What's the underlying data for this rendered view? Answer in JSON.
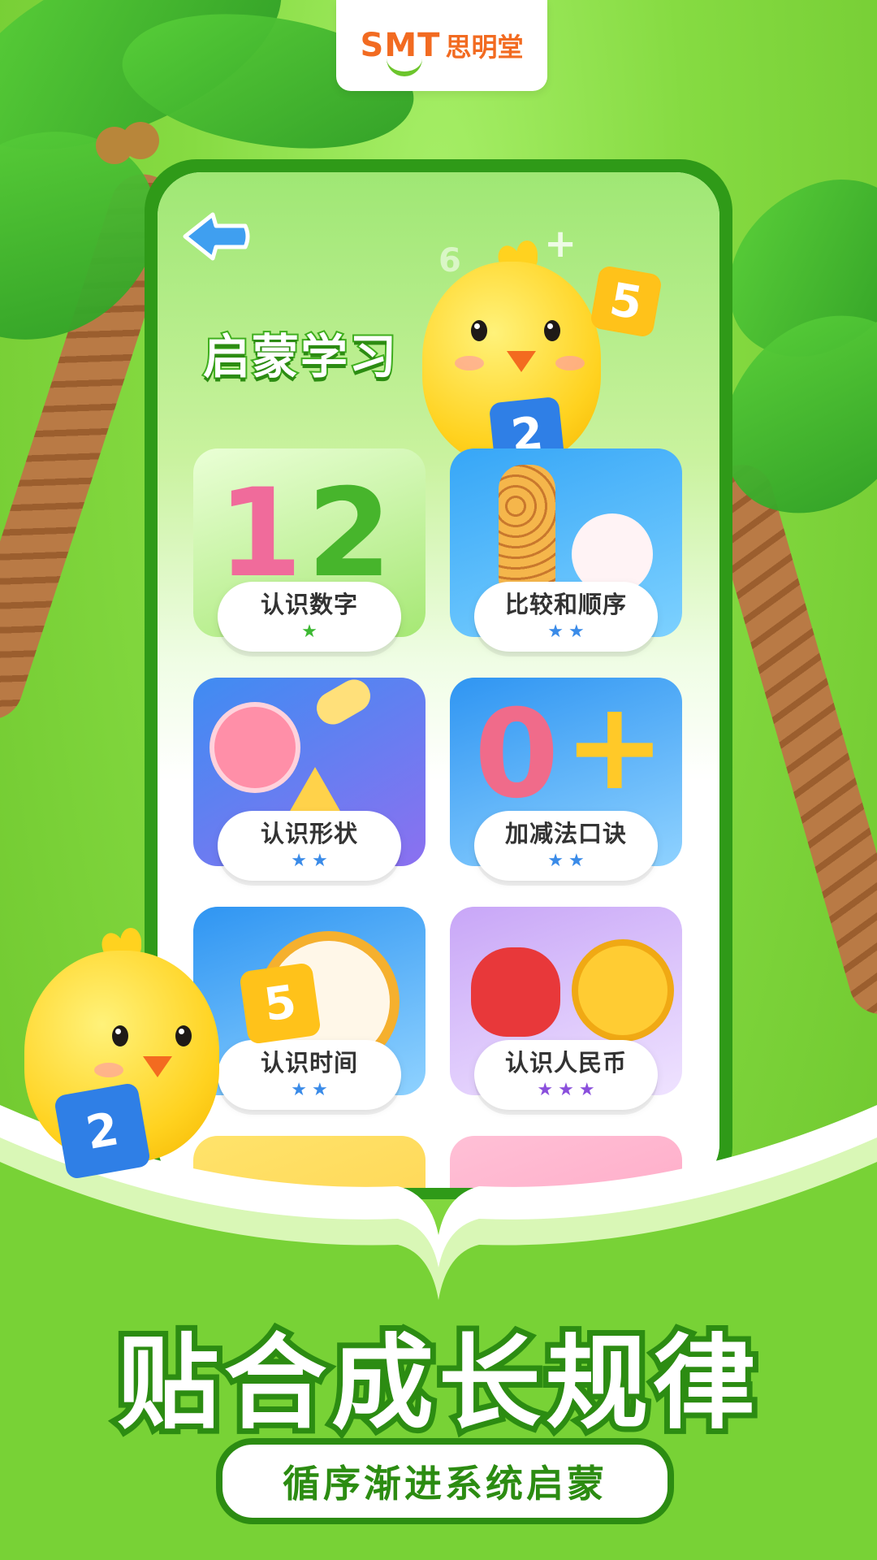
{
  "brand": {
    "logo_mark": "SMT",
    "name": "思明堂"
  },
  "page": {
    "title": "启蒙学习",
    "back_icon": "back-arrow-icon"
  },
  "lessons": [
    {
      "label": "认识数字",
      "stars": 1,
      "star_color": "#3cb832",
      "art": "numbers-12"
    },
    {
      "label": "比较和顺序",
      "stars": 2,
      "star_color": "#3a8be8",
      "art": "giraffe-rabbit"
    },
    {
      "label": "认识形状",
      "stars": 2,
      "star_color": "#3a8be8",
      "art": "space-shapes"
    },
    {
      "label": "加减法口诀",
      "stars": 2,
      "star_color": "#3a8be8",
      "art": "zero-plus"
    },
    {
      "label": "认识时间",
      "stars": 2,
      "star_color": "#3a8be8",
      "art": "alarm-clock"
    },
    {
      "label": "认识人民币",
      "stars": 3,
      "star_color": "#8a4fdc",
      "art": "money-bag-coin"
    },
    {
      "label": "",
      "stars": 0,
      "star_color": "#3a8be8",
      "art": "partial-yellow"
    },
    {
      "label": "",
      "stars": 0,
      "star_color": "#3a8be8",
      "art": "partial-pink"
    }
  ],
  "mascot": {
    "block_numbers": [
      "2",
      "5"
    ],
    "deco_number": "6"
  },
  "promo": {
    "headline": "贴合成长规律",
    "subline": "循序渐进系统启蒙"
  },
  "colors": {
    "primary_green": "#2c8c12",
    "accent_orange": "#f26b21"
  }
}
